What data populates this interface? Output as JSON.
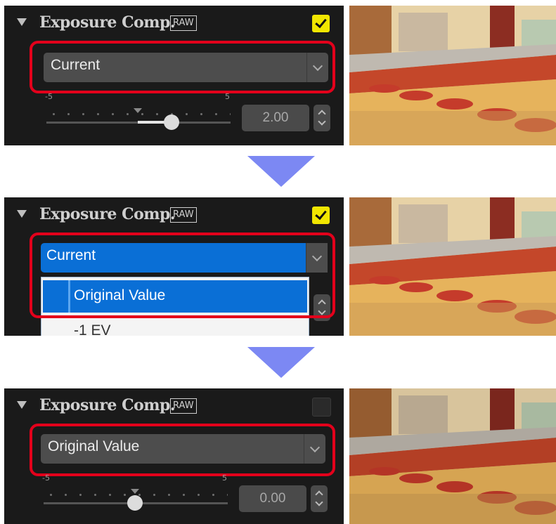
{
  "panels": [
    {
      "title": "Exposure Comp.",
      "badge": "RAW",
      "checked": true,
      "dropdown_value": "Current",
      "slider_min_label": "-5",
      "slider_max_label": "5",
      "numeric_value": "2.00"
    },
    {
      "title": "Exposure Comp.",
      "badge": "RAW",
      "checked": true,
      "dropdown_value": "Current",
      "dropdown_options": [
        "Original Value",
        "-1 EV"
      ]
    },
    {
      "title": "Exposure Comp.",
      "badge": "RAW",
      "checked": false,
      "dropdown_value": "Original Value",
      "slider_min_label": "-5",
      "slider_max_label": "5",
      "numeric_value": "0.00"
    }
  ],
  "colors": {
    "highlight": "#e3001b",
    "checkbox_on": "#f1e600",
    "selected_option": "#0a6fd6",
    "step_arrow": "#7c88f3"
  },
  "icons": [
    "collapse-triangle-icon",
    "checkmark-icon",
    "chevron-down-icon",
    "spin-up-down-icon",
    "step-down-arrow-icon"
  ]
}
